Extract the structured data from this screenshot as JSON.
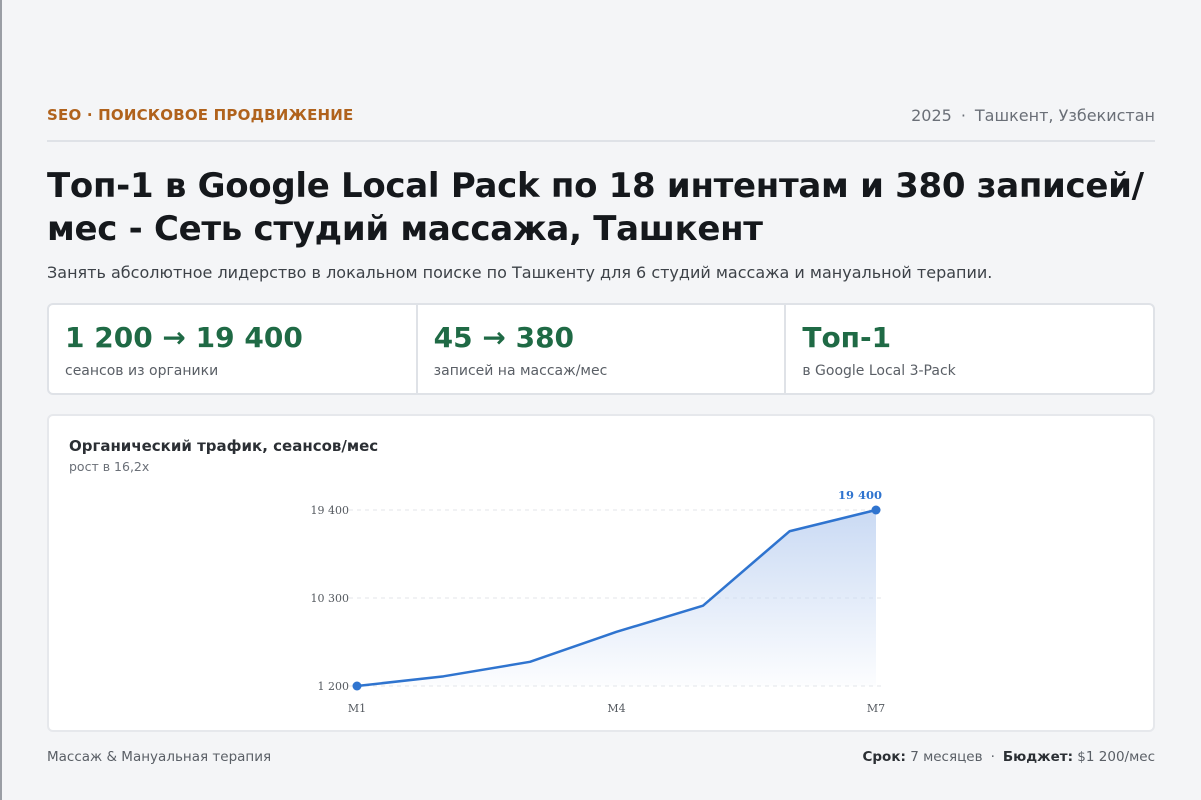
{
  "header": {
    "category": "SEO · ПОИСКОВОЕ ПРОДВИЖЕНИЕ",
    "year": "2025",
    "location": "Ташкент, Узбекистан"
  },
  "title": "Топ-1 в Google Local Pack по 18 интентам и 380 записей/мес - Сеть студий массажа, Ташкент",
  "subtitle": "Занять абсолютное лидерство в локальном поиске по Ташкенту для 6 студий массажа и мануальной терапии.",
  "stats": [
    {
      "value": "1 200 → 19 400",
      "label": "сеансов из органики"
    },
    {
      "value": "45 → 380",
      "label": "записей на массаж/мес"
    },
    {
      "value": "Топ-1",
      "label": "в Google Local 3-Pack"
    }
  ],
  "chart": {
    "title": "Органический трафик, сеансов/мес",
    "subtitle": "рост в 16,2x"
  },
  "chart_data": {
    "type": "area",
    "categories": [
      "M1",
      "M2",
      "M3",
      "M4",
      "M5",
      "M6",
      "M7"
    ],
    "x_tick_labels": [
      "M1",
      "M4",
      "M7"
    ],
    "values": [
      1200,
      2200,
      3700,
      6800,
      9500,
      17200,
      19400
    ],
    "y_ticks": [
      1200,
      10300,
      19400
    ],
    "y_tick_labels": [
      "1 200",
      "10 300",
      "19 400"
    ],
    "ylim": [
      1200,
      19400
    ],
    "end_label": "19 400",
    "grid": true,
    "colors": {
      "line": "#2f74cf",
      "fill": "#c7d8f3",
      "stat": "#1f6a45",
      "accent": "#b0621c"
    }
  },
  "footer": {
    "left": "Массаж & Мануальная терапия",
    "duration_label": "Срок:",
    "duration_value": "7 месяцев",
    "budget_label": "Бюджет:",
    "budget_value": "$1 200/мес"
  }
}
